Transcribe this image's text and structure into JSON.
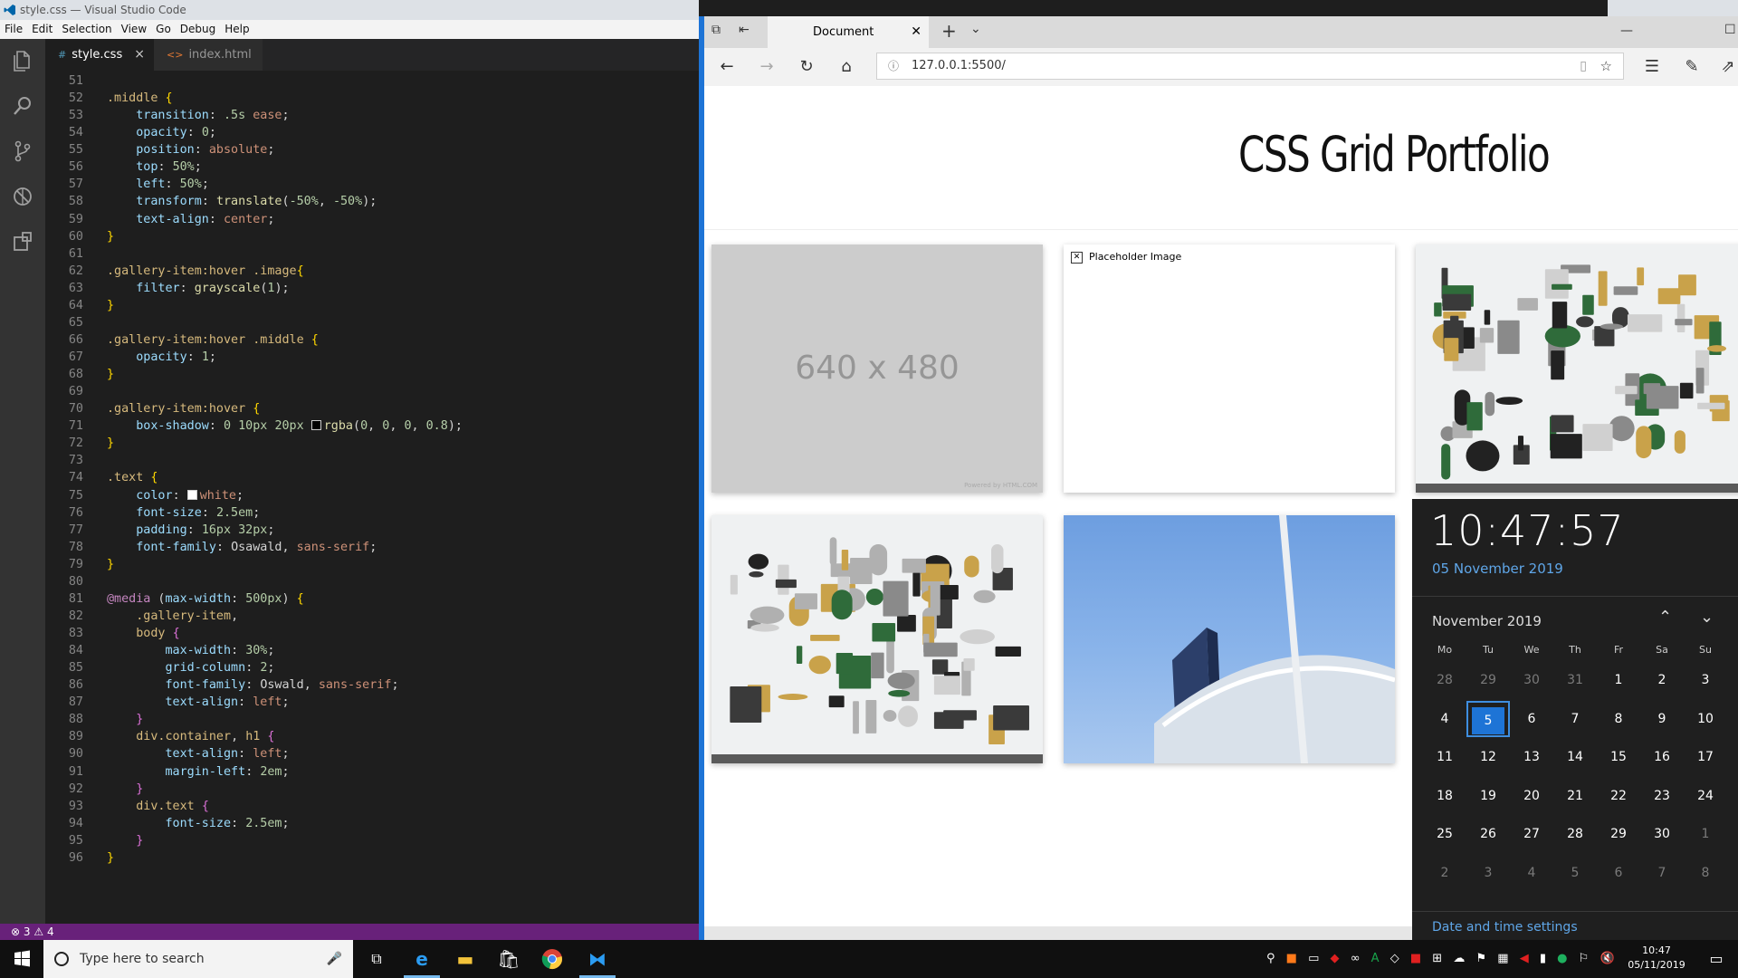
{
  "vscode": {
    "title": "style.css — Visual Studio Code",
    "menu": [
      "File",
      "Edit",
      "Selection",
      "View",
      "Go",
      "Debug",
      "Help"
    ],
    "tabs": [
      "style.css",
      "index.html"
    ],
    "status": {
      "errors": "3",
      "warnings": "4"
    },
    "code_lines": [
      {
        "n": "51",
        "segs": []
      },
      {
        "n": "52",
        "segs": [
          [
            ".middle ",
            "sel"
          ],
          [
            "{",
            "br1"
          ]
        ]
      },
      {
        "n": "53",
        "segs": [
          [
            "    transition",
            "prop"
          ],
          [
            ": ",
            "pun"
          ],
          [
            ".5s",
            "num"
          ],
          [
            " ease",
            "val"
          ],
          [
            ";",
            "pun"
          ]
        ]
      },
      {
        "n": "54",
        "segs": [
          [
            "    opacity",
            "prop"
          ],
          [
            ": ",
            "pun"
          ],
          [
            "0",
            "num"
          ],
          [
            ";",
            "pun"
          ]
        ]
      },
      {
        "n": "55",
        "segs": [
          [
            "    position",
            "prop"
          ],
          [
            ": ",
            "pun"
          ],
          [
            "absolute",
            "val"
          ],
          [
            ";",
            "pun"
          ]
        ]
      },
      {
        "n": "56",
        "segs": [
          [
            "    top",
            "prop"
          ],
          [
            ": ",
            "pun"
          ],
          [
            "50%",
            "num"
          ],
          [
            ";",
            "pun"
          ]
        ]
      },
      {
        "n": "57",
        "segs": [
          [
            "    left",
            "prop"
          ],
          [
            ": ",
            "pun"
          ],
          [
            "50%",
            "num"
          ],
          [
            ";",
            "pun"
          ]
        ]
      },
      {
        "n": "58",
        "segs": [
          [
            "    transform",
            "prop"
          ],
          [
            ": ",
            "pun"
          ],
          [
            "translate",
            "fn"
          ],
          [
            "(",
            "pun"
          ],
          [
            "-50%",
            "num"
          ],
          [
            ", ",
            "pun"
          ],
          [
            "-50%",
            "num"
          ],
          [
            ");",
            "pun"
          ]
        ]
      },
      {
        "n": "59",
        "segs": [
          [
            "    text-align",
            "prop"
          ],
          [
            ": ",
            "pun"
          ],
          [
            "center",
            "val"
          ],
          [
            ";",
            "pun"
          ]
        ]
      },
      {
        "n": "60",
        "segs": [
          [
            "}",
            "br1"
          ]
        ]
      },
      {
        "n": "61",
        "segs": []
      },
      {
        "n": "62",
        "segs": [
          [
            ".gallery-item:hover .image",
            "sel"
          ],
          [
            "{",
            "br1"
          ]
        ]
      },
      {
        "n": "63",
        "segs": [
          [
            "    filter",
            "prop"
          ],
          [
            ": ",
            "pun"
          ],
          [
            "grayscale",
            "fn"
          ],
          [
            "(",
            "pun"
          ],
          [
            "1",
            "num"
          ],
          [
            ");",
            "pun"
          ]
        ]
      },
      {
        "n": "64",
        "segs": [
          [
            "}",
            "br1"
          ]
        ]
      },
      {
        "n": "65",
        "segs": []
      },
      {
        "n": "66",
        "segs": [
          [
            ".gallery-item:hover .middle ",
            "sel"
          ],
          [
            "{",
            "br1"
          ]
        ]
      },
      {
        "n": "67",
        "segs": [
          [
            "    opacity",
            "prop"
          ],
          [
            ": ",
            "pun"
          ],
          [
            "1",
            "num"
          ],
          [
            ";",
            "pun"
          ]
        ]
      },
      {
        "n": "68",
        "segs": [
          [
            "}",
            "br1"
          ]
        ]
      },
      {
        "n": "69",
        "segs": []
      },
      {
        "n": "70",
        "segs": [
          [
            ".gallery-item:hover ",
            "sel"
          ],
          [
            "{",
            "br1"
          ]
        ]
      },
      {
        "n": "71",
        "segs": [
          [
            "    box-shadow",
            "prop"
          ],
          [
            ": ",
            "pun"
          ],
          [
            "0",
            "num"
          ],
          [
            " ",
            "pun"
          ],
          [
            "10px",
            "num"
          ],
          [
            " ",
            "pun"
          ],
          [
            "20px",
            "num"
          ],
          [
            " ",
            "pun"
          ],
          [
            "",
            "swatch-black"
          ],
          [
            "rgba",
            "fn"
          ],
          [
            "(",
            "pun"
          ],
          [
            "0",
            "num"
          ],
          [
            ", ",
            "pun"
          ],
          [
            "0",
            "num"
          ],
          [
            ", ",
            "pun"
          ],
          [
            "0",
            "num"
          ],
          [
            ", ",
            "pun"
          ],
          [
            "0.8",
            "num"
          ],
          [
            ");",
            "pun"
          ]
        ]
      },
      {
        "n": "72",
        "segs": [
          [
            "}",
            "br1"
          ]
        ]
      },
      {
        "n": "73",
        "segs": []
      },
      {
        "n": "74",
        "segs": [
          [
            ".text ",
            "sel"
          ],
          [
            "{",
            "br1"
          ]
        ]
      },
      {
        "n": "75",
        "segs": [
          [
            "    color",
            "prop"
          ],
          [
            ": ",
            "pun"
          ],
          [
            "",
            "swatch-white"
          ],
          [
            "white",
            "val"
          ],
          [
            ";",
            "pun"
          ]
        ]
      },
      {
        "n": "76",
        "segs": [
          [
            "    font-size",
            "prop"
          ],
          [
            ": ",
            "pun"
          ],
          [
            "2.5em",
            "num"
          ],
          [
            ";",
            "pun"
          ]
        ]
      },
      {
        "n": "77",
        "segs": [
          [
            "    padding",
            "prop"
          ],
          [
            ": ",
            "pun"
          ],
          [
            "16px",
            "num"
          ],
          [
            " ",
            "pun"
          ],
          [
            "32px",
            "num"
          ],
          [
            ";",
            "pun"
          ]
        ]
      },
      {
        "n": "78",
        "segs": [
          [
            "    font-family",
            "prop"
          ],
          [
            ": ",
            "pun"
          ],
          [
            "Osawald",
            "pun"
          ],
          [
            ", ",
            "pun"
          ],
          [
            "sans-serif",
            "val"
          ],
          [
            ";",
            "pun"
          ]
        ]
      },
      {
        "n": "79",
        "segs": [
          [
            "}",
            "br1"
          ]
        ]
      },
      {
        "n": "80",
        "segs": []
      },
      {
        "n": "81",
        "segs": [
          [
            "@media",
            "kw"
          ],
          [
            " (",
            "pun"
          ],
          [
            "max-width",
            "prop"
          ],
          [
            ": ",
            "pun"
          ],
          [
            "500px",
            "num"
          ],
          [
            ") ",
            "pun"
          ],
          [
            "{",
            "br1"
          ]
        ]
      },
      {
        "n": "82",
        "segs": [
          [
            "    .gallery-item",
            "sel"
          ],
          [
            ",",
            "pun"
          ]
        ]
      },
      {
        "n": "83",
        "segs": [
          [
            "    body ",
            "sel"
          ],
          [
            "{",
            "br2"
          ]
        ]
      },
      {
        "n": "84",
        "segs": [
          [
            "        max-width",
            "prop"
          ],
          [
            ": ",
            "pun"
          ],
          [
            "30%",
            "num"
          ],
          [
            ";",
            "pun"
          ]
        ]
      },
      {
        "n": "85",
        "segs": [
          [
            "        grid-column",
            "prop"
          ],
          [
            ": ",
            "pun"
          ],
          [
            "2",
            "num"
          ],
          [
            ";",
            "pun"
          ]
        ]
      },
      {
        "n": "86",
        "segs": [
          [
            "        font-family",
            "prop"
          ],
          [
            ": ",
            "pun"
          ],
          [
            "Oswald",
            "pun"
          ],
          [
            ", ",
            "pun"
          ],
          [
            "sans-serif",
            "val"
          ],
          [
            ";",
            "pun"
          ]
        ]
      },
      {
        "n": "87",
        "segs": [
          [
            "        text-align",
            "prop"
          ],
          [
            ": ",
            "pun"
          ],
          [
            "left",
            "val"
          ],
          [
            ";",
            "pun"
          ]
        ]
      },
      {
        "n": "88",
        "segs": [
          [
            "    }",
            "br2"
          ]
        ]
      },
      {
        "n": "89",
        "segs": [
          [
            "    div.container",
            "sel"
          ],
          [
            ", ",
            "pun"
          ],
          [
            "h1 ",
            "sel"
          ],
          [
            "{",
            "br2"
          ]
        ]
      },
      {
        "n": "90",
        "segs": [
          [
            "        text-align",
            "prop"
          ],
          [
            ": ",
            "pun"
          ],
          [
            "left",
            "val"
          ],
          [
            ";",
            "pun"
          ]
        ]
      },
      {
        "n": "91",
        "segs": [
          [
            "        margin-left",
            "prop"
          ],
          [
            ": ",
            "pun"
          ],
          [
            "2em",
            "num"
          ],
          [
            ";",
            "pun"
          ]
        ]
      },
      {
        "n": "92",
        "segs": [
          [
            "    }",
            "br2"
          ]
        ]
      },
      {
        "n": "93",
        "segs": [
          [
            "    div.text ",
            "sel"
          ],
          [
            "{",
            "br2"
          ]
        ]
      },
      {
        "n": "94",
        "segs": [
          [
            "        font-size",
            "prop"
          ],
          [
            ": ",
            "pun"
          ],
          [
            "2.5em",
            "num"
          ],
          [
            ";",
            "pun"
          ]
        ]
      },
      {
        "n": "95",
        "segs": [
          [
            "    }",
            "br2"
          ]
        ]
      },
      {
        "n": "96",
        "segs": [
          [
            "}",
            "br1"
          ]
        ]
      }
    ]
  },
  "browser": {
    "tab_title": "Document",
    "url": "127.0.0.1:5500/"
  },
  "page": {
    "title": "CSS Grid Portfolio",
    "gallery": [
      {
        "type": "placeholder",
        "label": "640 x 480",
        "credit": "Powered by HTML.COM"
      },
      {
        "type": "broken-image",
        "alt": "Placeholder Image"
      },
      {
        "type": "photo",
        "subject": "camera-parts"
      },
      {
        "type": "photo",
        "subject": "camera-parts"
      },
      {
        "type": "photo",
        "subject": "building-bridge"
      }
    ]
  },
  "flyout": {
    "time": "10:47:57",
    "date": "05 November 2019",
    "month": "November 2019",
    "weekdays": [
      "Mo",
      "Tu",
      "We",
      "Th",
      "Fr",
      "Sa",
      "Su"
    ],
    "weeks": [
      [
        [
          "28",
          true
        ],
        [
          "29",
          true
        ],
        [
          "30",
          true
        ],
        [
          "31",
          true
        ],
        [
          "1",
          false
        ],
        [
          "2",
          false
        ],
        [
          "3",
          false
        ]
      ],
      [
        [
          "4",
          false
        ],
        [
          "5",
          false
        ],
        [
          "6",
          false
        ],
        [
          "7",
          false
        ],
        [
          "8",
          false
        ],
        [
          "9",
          false
        ],
        [
          "10",
          false
        ]
      ],
      [
        [
          "11",
          false
        ],
        [
          "12",
          false
        ],
        [
          "13",
          false
        ],
        [
          "14",
          false
        ],
        [
          "15",
          false
        ],
        [
          "16",
          false
        ],
        [
          "17",
          false
        ]
      ],
      [
        [
          "18",
          false
        ],
        [
          "19",
          false
        ],
        [
          "20",
          false
        ],
        [
          "21",
          false
        ],
        [
          "22",
          false
        ],
        [
          "23",
          false
        ],
        [
          "24",
          false
        ]
      ],
      [
        [
          "25",
          false
        ],
        [
          "26",
          false
        ],
        [
          "27",
          false
        ],
        [
          "28",
          false
        ],
        [
          "29",
          false
        ],
        [
          "30",
          false
        ],
        [
          "1",
          true
        ]
      ],
      [
        [
          "2",
          true
        ],
        [
          "3",
          true
        ],
        [
          "4",
          true
        ],
        [
          "5",
          true
        ],
        [
          "6",
          true
        ],
        [
          "7",
          true
        ],
        [
          "8",
          true
        ]
      ]
    ],
    "today": "5",
    "settings_link": "Date and time settings"
  },
  "taskbar": {
    "search_placeholder": "Type here to search",
    "time": "10:47",
    "date": "05/11/2019"
  }
}
